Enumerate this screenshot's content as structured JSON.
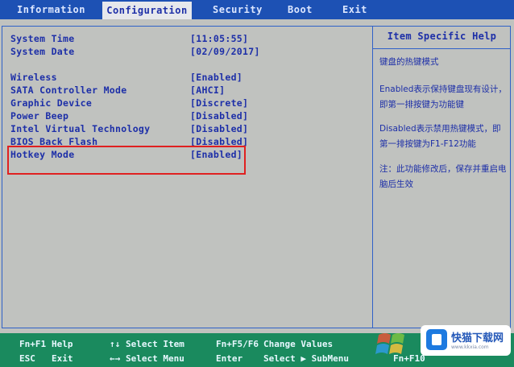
{
  "tabs": [
    {
      "label": "Information",
      "active": false
    },
    {
      "label": "Configuration",
      "active": true
    },
    {
      "label": "Security",
      "active": false
    },
    {
      "label": "Boot",
      "active": false
    },
    {
      "label": "Exit",
      "active": false
    }
  ],
  "settings": [
    {
      "label": "System Time",
      "value": "[11:05:55]"
    },
    {
      "label": "System Date",
      "value": "[02/09/2017]"
    },
    {
      "label": "Wireless",
      "value": "[Enabled]"
    },
    {
      "label": "SATA Controller Mode",
      "value": "[AHCI]"
    },
    {
      "label": "Graphic Device",
      "value": "[Discrete]"
    },
    {
      "label": "Power Beep",
      "value": "[Disabled]"
    },
    {
      "label": "Intel Virtual Technology",
      "value": "[Disabled]"
    },
    {
      "label": "BIOS Back Flash",
      "value": "[Disabled]"
    },
    {
      "label": "Hotkey Mode",
      "value": "[Enabled]"
    }
  ],
  "help": {
    "title": "Item Specific Help",
    "paragraphs": [
      "键盘的热键模式",
      "Enabled表示保持键盘现有设计，即第一排按键为功能键",
      "Disabled表示禁用热键模式，即第一排按键为F1-F12功能",
      "注：此功能修改后，保存并重启电脑后生效"
    ]
  },
  "footer": [
    {
      "key": "Fn+F1",
      "desc": "Help"
    },
    {
      "key": "ESC",
      "desc": "Exit"
    },
    {
      "key": "↑↓",
      "desc": "Select Item"
    },
    {
      "key": "←→",
      "desc": "Select Menu"
    },
    {
      "key": "Fn+F5/F6",
      "desc": "Change Values"
    },
    {
      "key": "Enter",
      "desc": "Select ▶ SubMenu"
    },
    {
      "key": "Fn+F10",
      "desc": ""
    }
  ],
  "watermark": {
    "title": "快猫下载网",
    "url": "www.kkxia.com"
  },
  "colors": {
    "topbar": "#1d51b4",
    "text": "#1d2fa8",
    "panel_bg": "#c0c2bf",
    "footer": "#1a8a5e",
    "highlight": "#e02020"
  }
}
